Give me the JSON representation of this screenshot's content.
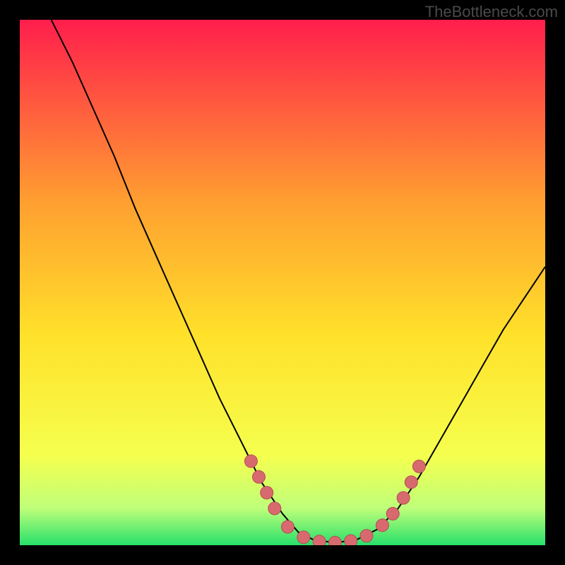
{
  "watermark": "TheBottleneck.com",
  "colors": {
    "background": "#000000",
    "gradient_top": "#ff1e4c",
    "gradient_mid1": "#ffa030",
    "gradient_mid2": "#ffe12a",
    "gradient_low": "#f5ff4e",
    "gradient_green_light": "#beff7a",
    "gradient_green": "#27e06a",
    "curve": "#000000",
    "marker_fill": "#d86a6f",
    "marker_stroke": "#b14e54"
  },
  "chart_data": {
    "type": "line",
    "title": "",
    "xlabel": "",
    "ylabel": "",
    "xlim": [
      0,
      100
    ],
    "ylim": [
      0,
      100
    ],
    "curve": [
      {
        "x": 6,
        "y": 100
      },
      {
        "x": 10,
        "y": 92
      },
      {
        "x": 14,
        "y": 83
      },
      {
        "x": 18,
        "y": 74
      },
      {
        "x": 22,
        "y": 64
      },
      {
        "x": 26,
        "y": 55
      },
      {
        "x": 30,
        "y": 46
      },
      {
        "x": 34,
        "y": 37
      },
      {
        "x": 38,
        "y": 28
      },
      {
        "x": 42,
        "y": 20
      },
      {
        "x": 46,
        "y": 12
      },
      {
        "x": 50,
        "y": 6
      },
      {
        "x": 53,
        "y": 2.5
      },
      {
        "x": 56,
        "y": 1
      },
      {
        "x": 60,
        "y": 0.5
      },
      {
        "x": 64,
        "y": 1
      },
      {
        "x": 68,
        "y": 3
      },
      {
        "x": 72,
        "y": 7
      },
      {
        "x": 76,
        "y": 13
      },
      {
        "x": 80,
        "y": 20
      },
      {
        "x": 84,
        "y": 27
      },
      {
        "x": 88,
        "y": 34
      },
      {
        "x": 92,
        "y": 41
      },
      {
        "x": 96,
        "y": 47
      },
      {
        "x": 100,
        "y": 53
      }
    ],
    "markers": [
      {
        "x": 44,
        "y": 16
      },
      {
        "x": 45.5,
        "y": 13
      },
      {
        "x": 47,
        "y": 10
      },
      {
        "x": 48.5,
        "y": 7
      },
      {
        "x": 51,
        "y": 3.5
      },
      {
        "x": 54,
        "y": 1.5
      },
      {
        "x": 57,
        "y": 0.7
      },
      {
        "x": 60,
        "y": 0.5
      },
      {
        "x": 63,
        "y": 0.8
      },
      {
        "x": 66,
        "y": 1.8
      },
      {
        "x": 69,
        "y": 3.8
      },
      {
        "x": 71,
        "y": 6
      },
      {
        "x": 73,
        "y": 9
      },
      {
        "x": 74.5,
        "y": 12
      },
      {
        "x": 76,
        "y": 15
      }
    ]
  }
}
